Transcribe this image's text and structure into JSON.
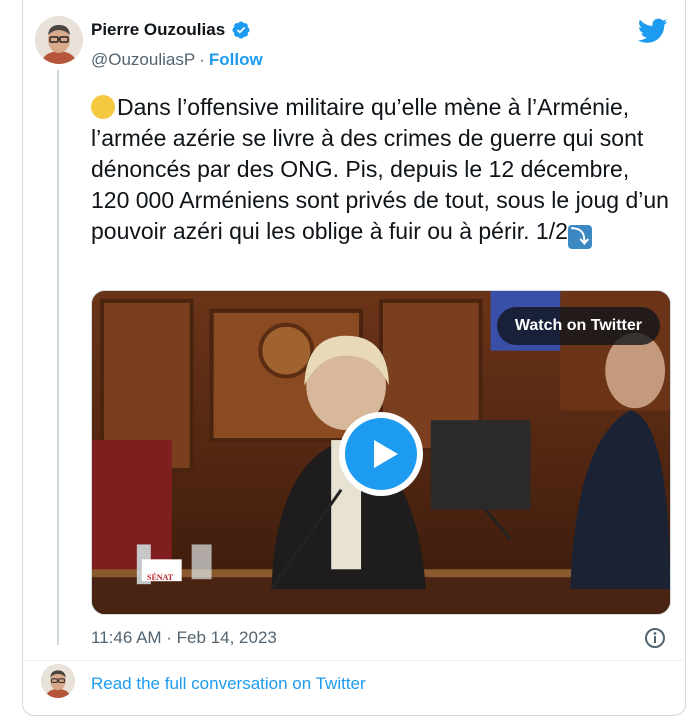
{
  "author": {
    "name": "Pierre Ouzoulias",
    "handle": "@OuzouliasP",
    "separator": "·",
    "follow_label": "Follow"
  },
  "tweet": {
    "text_main": "Dans l’offensive militaire qu’elle mène à l’Arménie, l’armée azérie se livre à des crimes de guerre qui sont dénoncés par des ONG. Pis, depuis le 12 décembre, 120 000 Arméniens sont privés de tout, sous le joug d’un pouvoir azéri qui les oblige à fuir ou à périr.  1/2",
    "emoji_start": "yellow-circle-emoji",
    "emoji_end": "right-arrow-curving-down-emoji",
    "emoji_end_glyph": "⤵"
  },
  "media": {
    "watch_label": "Watch on Twitter",
    "placard_text": "SÉNAT"
  },
  "footer": {
    "timestamp": "11:46 AM · Feb 14, 2023",
    "read_link": "Read the full conversation on Twitter"
  },
  "icons": {
    "verified": "verified-badge-icon",
    "twitter": "twitter-bird-icon",
    "play": "play-icon",
    "info": "info-icon"
  },
  "colors": {
    "accent": "#1d9bf0",
    "text": "#0f1419",
    "muted": "#536471",
    "border": "#cfd9de"
  }
}
